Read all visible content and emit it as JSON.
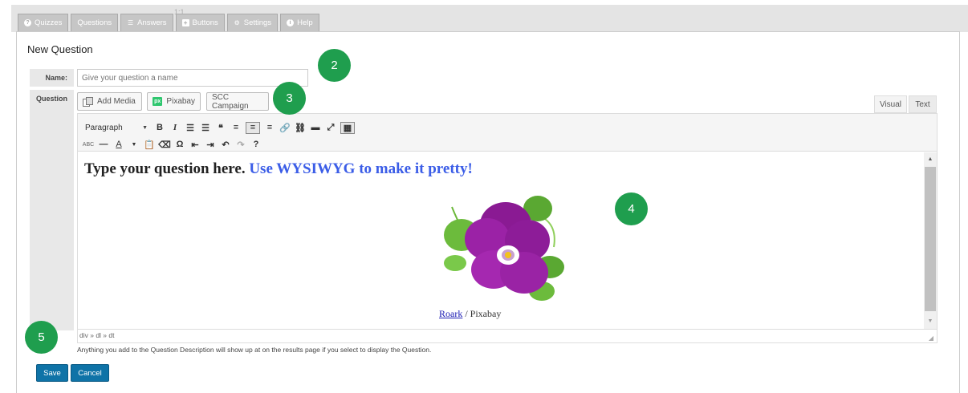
{
  "tabs": [
    {
      "label": "Quizzes",
      "icon": "question-circle-icon"
    },
    {
      "label": "Questions",
      "icon": ""
    },
    {
      "label": "Answers",
      "icon": "list-icon"
    },
    {
      "label": "Buttons",
      "icon": "plus-square-icon"
    },
    {
      "label": "Settings",
      "icon": "gears-icon"
    },
    {
      "label": "Help",
      "icon": "info-circle-icon"
    }
  ],
  "mini_label": "1:1",
  "panel": {
    "title": "New Question"
  },
  "form": {
    "name_label": "Name:",
    "name_placeholder": "Give your question a name",
    "question_label": "Question"
  },
  "media_buttons": {
    "add_media": "Add Media",
    "pixabay": "Pixabay",
    "pixabay_badge": "px",
    "scc": "SCC Campaign"
  },
  "editor_tabs": {
    "visual": "Visual",
    "text": "Text"
  },
  "toolbar": {
    "format_select": "Paragraph"
  },
  "content": {
    "question_text": "Type your question here.",
    "question_highlight": "Use WYSIWYG to make it pretty!",
    "image_credit_author": "Roark",
    "image_credit_sep": " / ",
    "image_credit_source": "Pixabay"
  },
  "status_path": "div » dl » dt",
  "hint": "Anything you add to the Question Description will show up at on the results page if you select to display the Question.",
  "buttons": {
    "save": "Save",
    "cancel": "Cancel"
  },
  "markers": [
    "2",
    "3",
    "4",
    "5"
  ],
  "colors": {
    "accent": "#0f73a7",
    "marker": "#1f9e4e",
    "highlight_text": "#3b5de7",
    "link": "#1b1bb3"
  }
}
